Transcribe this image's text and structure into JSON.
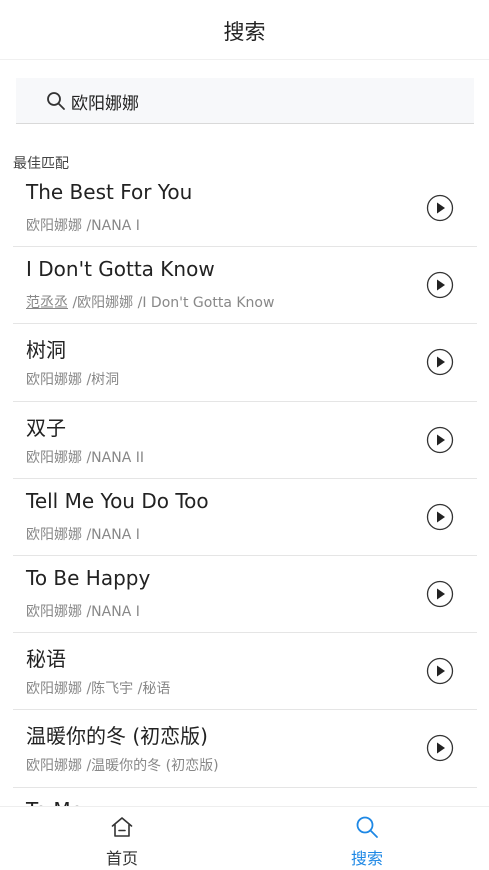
{
  "header": {
    "title": "搜索"
  },
  "search": {
    "value": "欧阳娜娜"
  },
  "section": {
    "label": "最佳匹配"
  },
  "songs": [
    {
      "title": "The Best For You",
      "artist": "欧阳娜娜",
      "album": "NANA I",
      "artist_underlined": false
    },
    {
      "title": "I Don't Gotta Know",
      "artist_pre": "范丞丞",
      "artist": "欧阳娜娜",
      "album": "I Don't Gotta Know",
      "artist_underlined": true
    },
    {
      "title": "树洞",
      "artist": "欧阳娜娜",
      "album": "树洞",
      "artist_underlined": false
    },
    {
      "title": "双子",
      "artist": "欧阳娜娜",
      "album": "NANA II",
      "artist_underlined": false
    },
    {
      "title": "Tell Me You Do Too",
      "artist": "欧阳娜娜",
      "album": "NANA I",
      "artist_underlined": false
    },
    {
      "title": "To Be Happy",
      "artist": "欧阳娜娜",
      "album": "NANA I",
      "artist_underlined": false
    },
    {
      "title": "秘语",
      "artist": "欧阳娜娜",
      "artist2": "陈飞宇",
      "album": "秘语",
      "artist_underlined": false
    },
    {
      "title": "温暖你的冬 (初恋版)",
      "artist": "欧阳娜娜",
      "album": "温暖你的冬 (初恋版)",
      "artist_underlined": false
    },
    {
      "title": "To Me",
      "artist": "",
      "album": "",
      "artist_underlined": false
    }
  ],
  "tabs": [
    {
      "label": "首页",
      "icon": "home-icon",
      "active": false
    },
    {
      "label": "搜索",
      "icon": "search-icon",
      "active": true
    }
  ],
  "colors": {
    "accent": "#1e88e5"
  }
}
